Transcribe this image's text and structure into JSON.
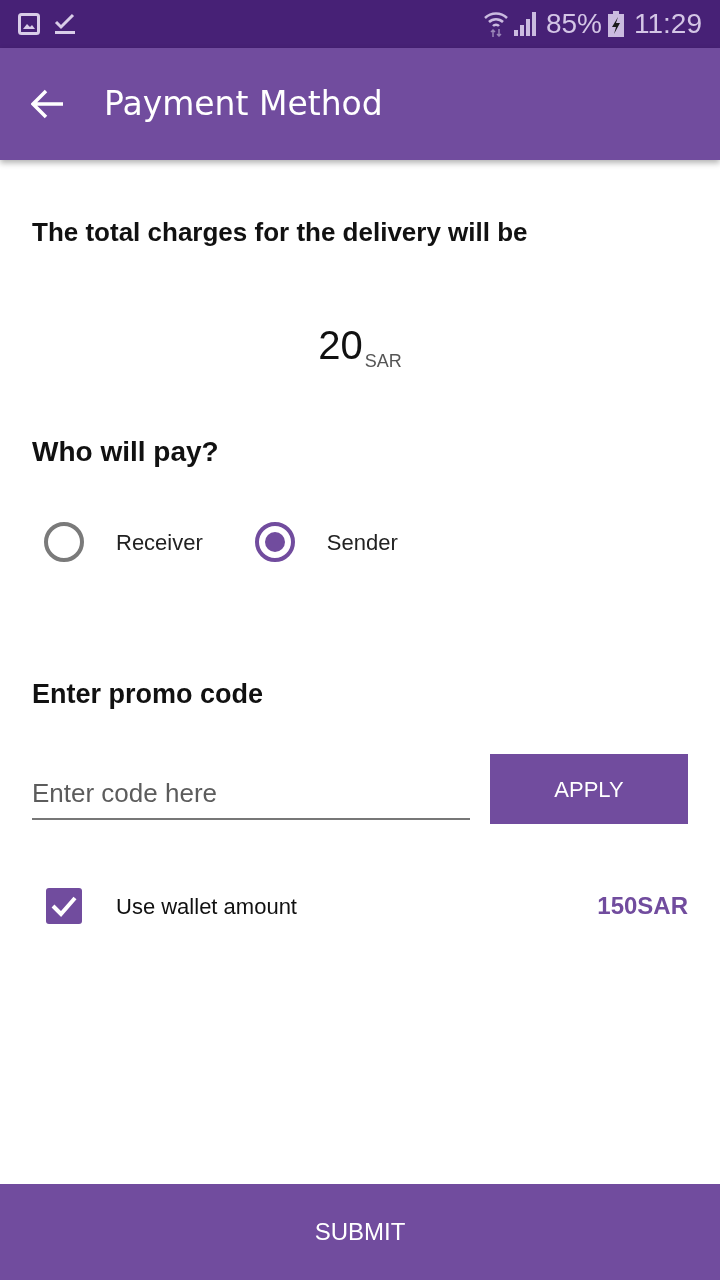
{
  "status_bar": {
    "battery": "85%",
    "time": "11:29"
  },
  "app_bar": {
    "title": "Payment Method"
  },
  "charges": {
    "heading": "The total charges for the delivery will be",
    "amount": "20",
    "currency": "SAR"
  },
  "payer": {
    "heading": "Who will pay?",
    "options": [
      {
        "label": "Receiver",
        "selected": false
      },
      {
        "label": "Sender",
        "selected": true
      }
    ]
  },
  "promo": {
    "heading": "Enter promo code",
    "placeholder": "Enter code here",
    "button": "APPLY"
  },
  "wallet": {
    "label": "Use wallet amount",
    "checked": true,
    "amount": "150SAR"
  },
  "submit": "SUBMIT"
}
